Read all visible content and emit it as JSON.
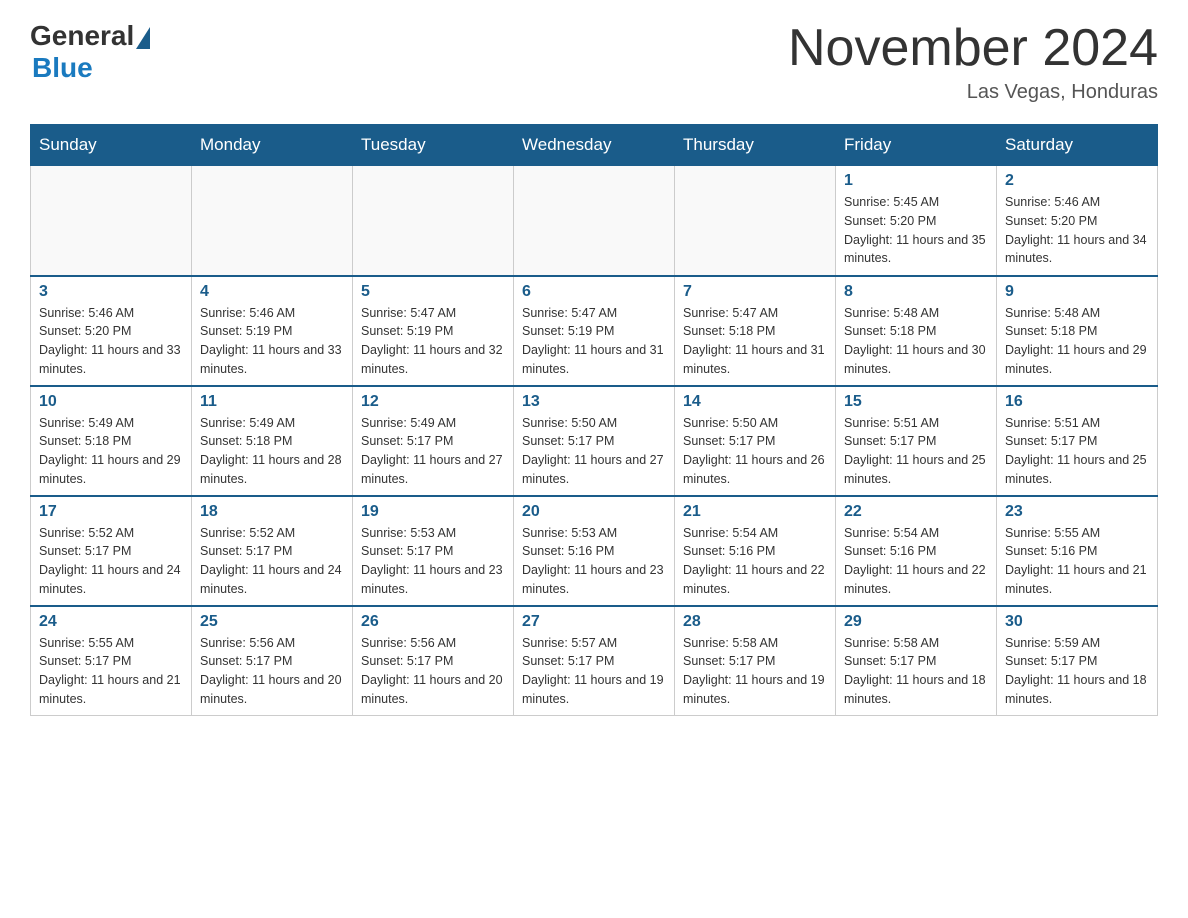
{
  "header": {
    "logo_general": "General",
    "logo_blue": "Blue",
    "month_title": "November 2024",
    "location": "Las Vegas, Honduras"
  },
  "days_of_week": [
    "Sunday",
    "Monday",
    "Tuesday",
    "Wednesday",
    "Thursday",
    "Friday",
    "Saturday"
  ],
  "weeks": [
    [
      {
        "day": "",
        "info": ""
      },
      {
        "day": "",
        "info": ""
      },
      {
        "day": "",
        "info": ""
      },
      {
        "day": "",
        "info": ""
      },
      {
        "day": "",
        "info": ""
      },
      {
        "day": "1",
        "info": "Sunrise: 5:45 AM\nSunset: 5:20 PM\nDaylight: 11 hours and 35 minutes."
      },
      {
        "day": "2",
        "info": "Sunrise: 5:46 AM\nSunset: 5:20 PM\nDaylight: 11 hours and 34 minutes."
      }
    ],
    [
      {
        "day": "3",
        "info": "Sunrise: 5:46 AM\nSunset: 5:20 PM\nDaylight: 11 hours and 33 minutes."
      },
      {
        "day": "4",
        "info": "Sunrise: 5:46 AM\nSunset: 5:19 PM\nDaylight: 11 hours and 33 minutes."
      },
      {
        "day": "5",
        "info": "Sunrise: 5:47 AM\nSunset: 5:19 PM\nDaylight: 11 hours and 32 minutes."
      },
      {
        "day": "6",
        "info": "Sunrise: 5:47 AM\nSunset: 5:19 PM\nDaylight: 11 hours and 31 minutes."
      },
      {
        "day": "7",
        "info": "Sunrise: 5:47 AM\nSunset: 5:18 PM\nDaylight: 11 hours and 31 minutes."
      },
      {
        "day": "8",
        "info": "Sunrise: 5:48 AM\nSunset: 5:18 PM\nDaylight: 11 hours and 30 minutes."
      },
      {
        "day": "9",
        "info": "Sunrise: 5:48 AM\nSunset: 5:18 PM\nDaylight: 11 hours and 29 minutes."
      }
    ],
    [
      {
        "day": "10",
        "info": "Sunrise: 5:49 AM\nSunset: 5:18 PM\nDaylight: 11 hours and 29 minutes."
      },
      {
        "day": "11",
        "info": "Sunrise: 5:49 AM\nSunset: 5:18 PM\nDaylight: 11 hours and 28 minutes."
      },
      {
        "day": "12",
        "info": "Sunrise: 5:49 AM\nSunset: 5:17 PM\nDaylight: 11 hours and 27 minutes."
      },
      {
        "day": "13",
        "info": "Sunrise: 5:50 AM\nSunset: 5:17 PM\nDaylight: 11 hours and 27 minutes."
      },
      {
        "day": "14",
        "info": "Sunrise: 5:50 AM\nSunset: 5:17 PM\nDaylight: 11 hours and 26 minutes."
      },
      {
        "day": "15",
        "info": "Sunrise: 5:51 AM\nSunset: 5:17 PM\nDaylight: 11 hours and 25 minutes."
      },
      {
        "day": "16",
        "info": "Sunrise: 5:51 AM\nSunset: 5:17 PM\nDaylight: 11 hours and 25 minutes."
      }
    ],
    [
      {
        "day": "17",
        "info": "Sunrise: 5:52 AM\nSunset: 5:17 PM\nDaylight: 11 hours and 24 minutes."
      },
      {
        "day": "18",
        "info": "Sunrise: 5:52 AM\nSunset: 5:17 PM\nDaylight: 11 hours and 24 minutes."
      },
      {
        "day": "19",
        "info": "Sunrise: 5:53 AM\nSunset: 5:17 PM\nDaylight: 11 hours and 23 minutes."
      },
      {
        "day": "20",
        "info": "Sunrise: 5:53 AM\nSunset: 5:16 PM\nDaylight: 11 hours and 23 minutes."
      },
      {
        "day": "21",
        "info": "Sunrise: 5:54 AM\nSunset: 5:16 PM\nDaylight: 11 hours and 22 minutes."
      },
      {
        "day": "22",
        "info": "Sunrise: 5:54 AM\nSunset: 5:16 PM\nDaylight: 11 hours and 22 minutes."
      },
      {
        "day": "23",
        "info": "Sunrise: 5:55 AM\nSunset: 5:16 PM\nDaylight: 11 hours and 21 minutes."
      }
    ],
    [
      {
        "day": "24",
        "info": "Sunrise: 5:55 AM\nSunset: 5:17 PM\nDaylight: 11 hours and 21 minutes."
      },
      {
        "day": "25",
        "info": "Sunrise: 5:56 AM\nSunset: 5:17 PM\nDaylight: 11 hours and 20 minutes."
      },
      {
        "day": "26",
        "info": "Sunrise: 5:56 AM\nSunset: 5:17 PM\nDaylight: 11 hours and 20 minutes."
      },
      {
        "day": "27",
        "info": "Sunrise: 5:57 AM\nSunset: 5:17 PM\nDaylight: 11 hours and 19 minutes."
      },
      {
        "day": "28",
        "info": "Sunrise: 5:58 AM\nSunset: 5:17 PM\nDaylight: 11 hours and 19 minutes."
      },
      {
        "day": "29",
        "info": "Sunrise: 5:58 AM\nSunset: 5:17 PM\nDaylight: 11 hours and 18 minutes."
      },
      {
        "day": "30",
        "info": "Sunrise: 5:59 AM\nSunset: 5:17 PM\nDaylight: 11 hours and 18 minutes."
      }
    ]
  ]
}
